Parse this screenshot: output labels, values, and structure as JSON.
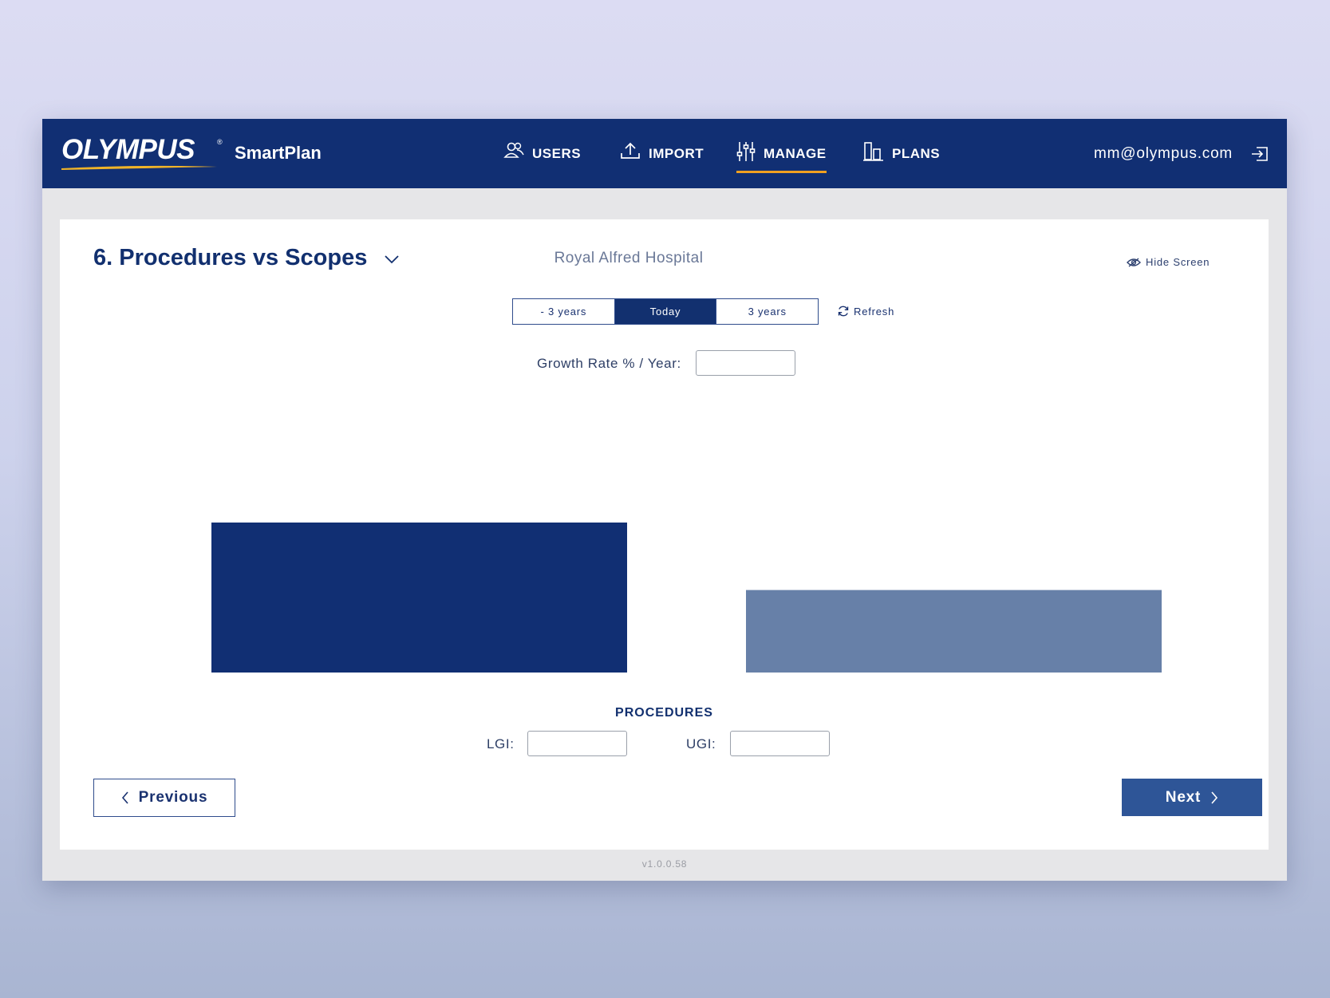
{
  "brand": {
    "logo_text": "OLYMPUS",
    "product": "SmartPlan"
  },
  "nav": {
    "items": [
      {
        "label": "USERS",
        "icon": "users-icon"
      },
      {
        "label": "IMPORT",
        "icon": "upload-icon"
      },
      {
        "label": "MANAGE",
        "icon": "sliders-icon",
        "active": true
      },
      {
        "label": "PLANS",
        "icon": "bar-chart-icon"
      }
    ],
    "user_email": "mm@olympus.com"
  },
  "page": {
    "title": "6. Procedures vs Scopes",
    "hospital": "Royal Alfred Hospital",
    "hide_screen": "Hide Screen",
    "timeframe": {
      "options": [
        "- 3 years",
        "Today",
        "3 years"
      ],
      "selected": "Today"
    },
    "refresh": "Refresh",
    "growth_label": "Growth Rate % / Year:",
    "growth_value": "",
    "procedures_title": "PROCEDURES",
    "lgi_label": "LGI:",
    "lgi_value": "",
    "ugi_label": "UGI:",
    "ugi_value": "",
    "prev": "Previous",
    "next": "Next"
  },
  "chart_data": {
    "type": "bar",
    "categories": [
      "LGI",
      "UGI"
    ],
    "values": [
      100,
      55
    ],
    "colors": [
      "#112f73",
      "#6780a8"
    ],
    "title": "",
    "xlabel": "",
    "ylabel": "",
    "ylim": [
      0,
      100
    ],
    "grid": false
  },
  "version": "v1.0.0.58",
  "colors": {
    "navbar": "#112f73",
    "accent": "#f0a020",
    "primary_button": "#2e5597"
  }
}
